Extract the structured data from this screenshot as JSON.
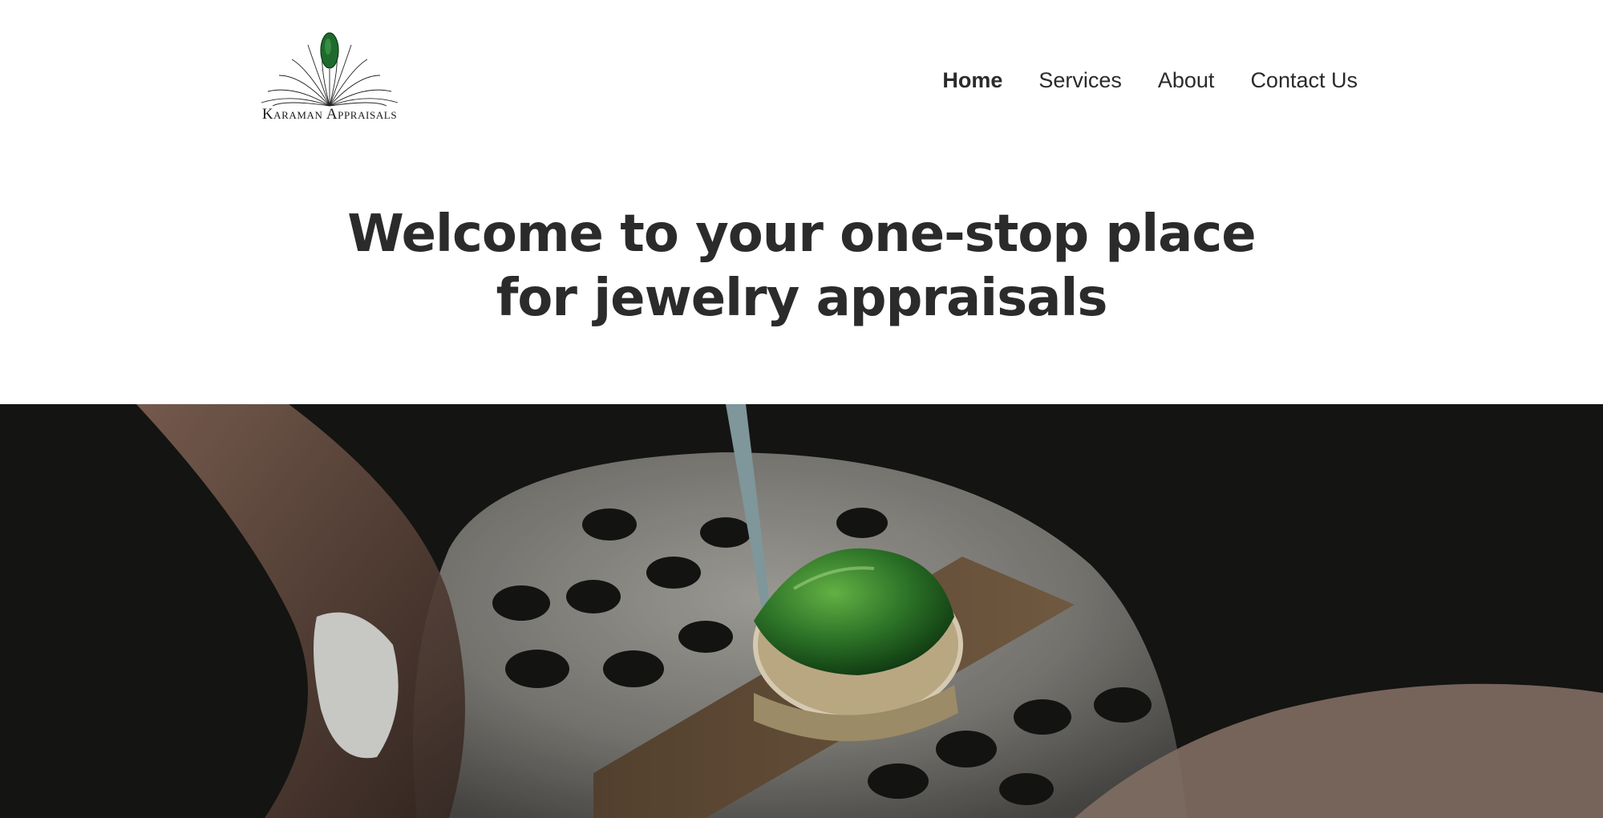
{
  "header": {
    "logo": {
      "text": "Karaman Appraisals",
      "icon": "marquise-emerald-fan-icon",
      "gem_color": "#1f6b2e"
    },
    "nav": [
      {
        "label": "Home",
        "active": true
      },
      {
        "label": "Services",
        "active": false
      },
      {
        "label": "About",
        "active": false
      },
      {
        "label": "Contact Us",
        "active": false
      }
    ]
  },
  "hero": {
    "title": "Welcome to your one-stop place for jewelry appraisals",
    "image": {
      "subject": "emerald-ring-on-bench-block",
      "accent_color": "#2f7a2a",
      "background_color": "#161614"
    }
  },
  "colors": {
    "text": "#2b2b2b",
    "background": "#ffffff"
  }
}
